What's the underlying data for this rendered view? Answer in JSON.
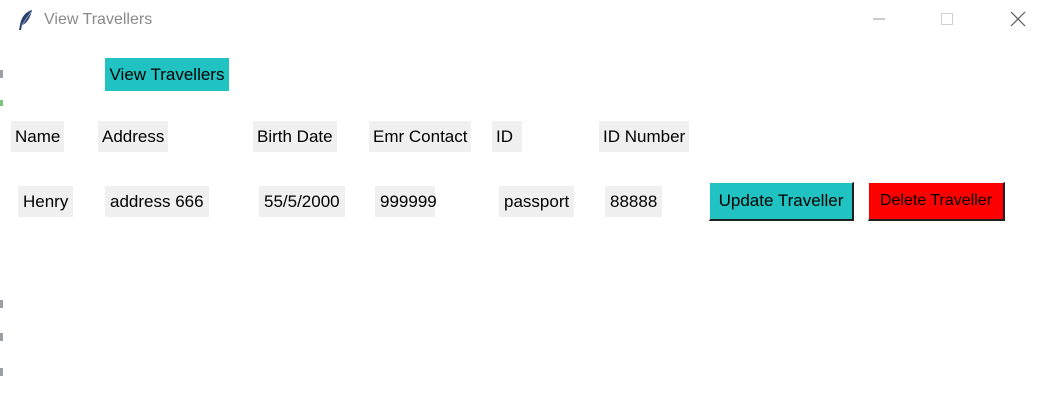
{
  "window": {
    "title": "View Travellers"
  },
  "toolbar": {
    "view_label": "View Travellers"
  },
  "table": {
    "headers": [
      "Name",
      "Address",
      "Birth Date",
      "Emr Contact",
      "ID",
      "ID Number"
    ],
    "rows": [
      {
        "name": "Henry",
        "address": "address 666",
        "birth_date": "55/5/2000",
        "emr_contact": "999999",
        "id_type": "passport",
        "id_number": "88888",
        "update_label": "Update Traveller",
        "delete_label": "Delete Traveller"
      }
    ]
  },
  "colors": {
    "accent": "#20c2c2",
    "danger": "#ff0000",
    "label_bg": "#f0f0f0"
  },
  "icons": {
    "app": "feather-icon",
    "minimize": "minimize-icon",
    "maximize": "maximize-icon",
    "close": "close-icon"
  }
}
